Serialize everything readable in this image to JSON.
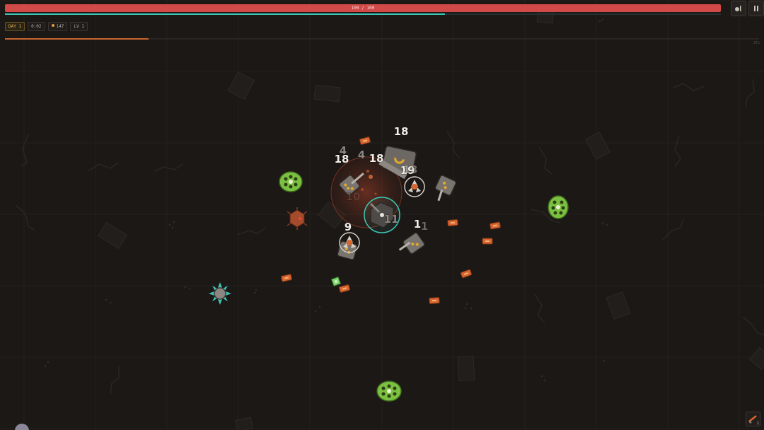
{
  "hud": {
    "hp_text": "100 / 100",
    "hp_fraction": 1.0,
    "xp_fraction": 0.615,
    "day_label": "DAY 1",
    "timer": "0:02",
    "coins": "147",
    "level": "LV 1",
    "wave_fraction": 0.19,
    "wave_timer": "37s",
    "weapon_count": "1"
  },
  "damage_numbers": [
    "18",
    "4",
    "4",
    "18",
    "18",
    "19",
    "10",
    "11",
    "1",
    "1",
    "9",
    "13"
  ],
  "colors": {
    "background": "#1b1816",
    "grid": "#24201d",
    "hp": "#d24a47",
    "xp": "#3ec6b5",
    "wave": "#c7662f",
    "day": "#e2b24e",
    "coin": "#e59a3c",
    "enemy_green": "#7cc041",
    "pickup_orange": "#d9652e",
    "player_ring": "#3ec6b5"
  },
  "icons": [
    "settings-icon",
    "pause-icon",
    "weapon-icon",
    "coin-icon"
  ]
}
